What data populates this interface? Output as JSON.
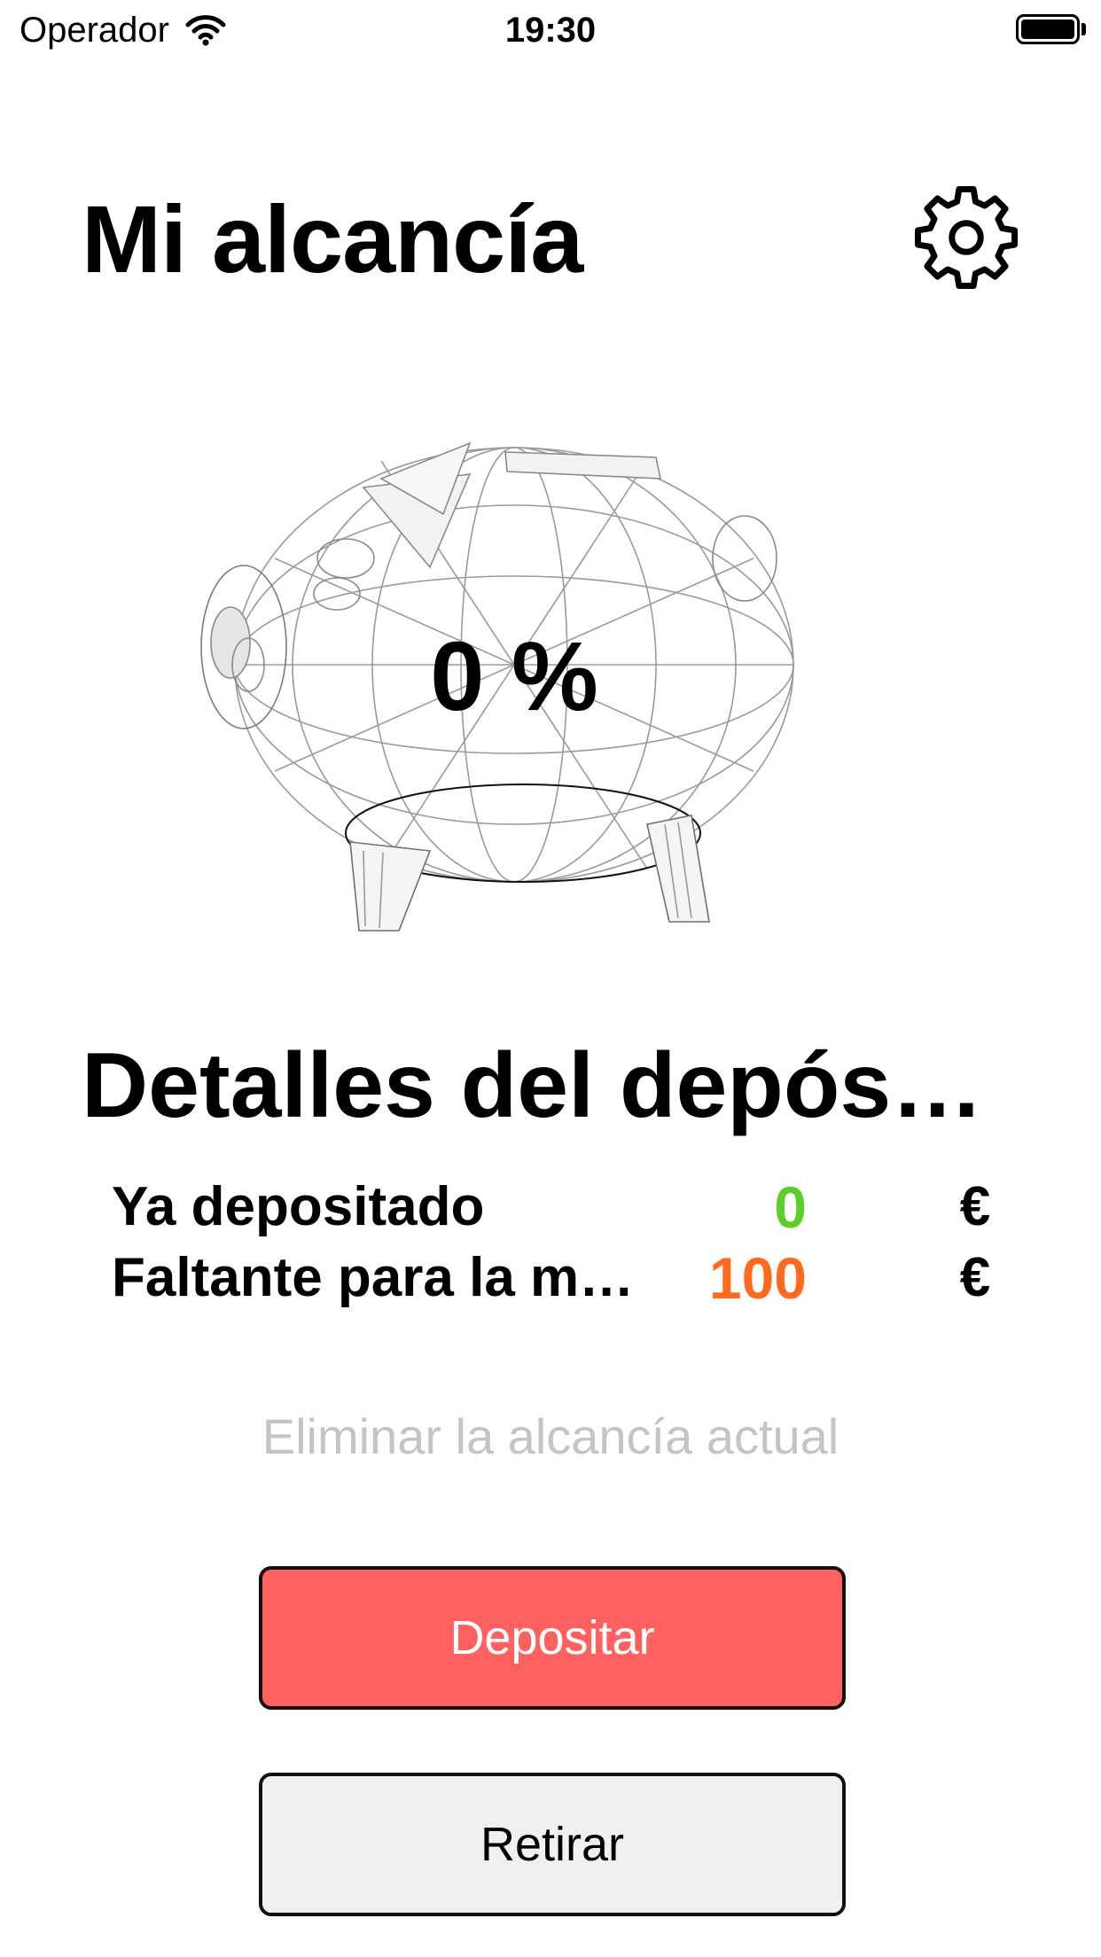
{
  "status_bar": {
    "carrier": "Operador",
    "time": "19:30"
  },
  "header": {
    "title": "Mi alcancía",
    "settings_icon": "gear-icon"
  },
  "piggy": {
    "percent_text": "0 %",
    "image": "piggy-bank-wireframe"
  },
  "details": {
    "title": "Detalles del depós…",
    "rows": [
      {
        "label": "Ya depositado",
        "value": "0",
        "currency": "€",
        "color": "#5ccf2a"
      },
      {
        "label": "Faltante para la m…",
        "value": "100",
        "currency": "€",
        "color": "#ff6a1f"
      }
    ]
  },
  "delete_link": "Eliminar la alcancía actual",
  "buttons": {
    "deposit": {
      "label": "Depositar",
      "bg": "#ff6161",
      "color": "#ffffff"
    },
    "withdraw": {
      "label": "Retirar",
      "bg": "#f0f0f0",
      "color": "#000000"
    }
  }
}
